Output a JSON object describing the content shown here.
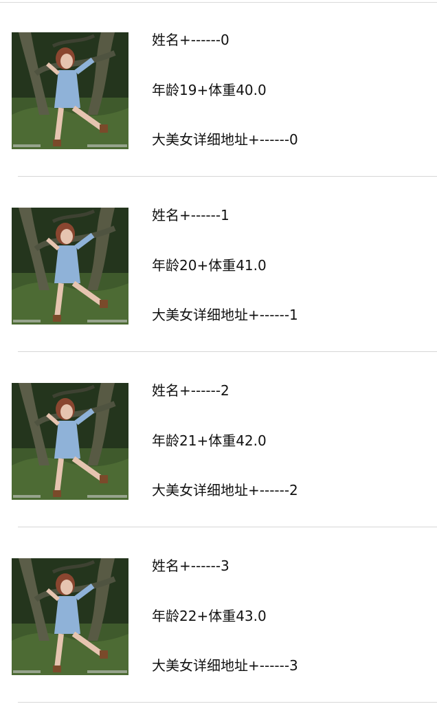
{
  "list": {
    "items": [
      {
        "name_line": "姓名+------0",
        "age_weight_line": "年龄19+体重40.0",
        "address_line": "大美女详细地址+------0"
      },
      {
        "name_line": "姓名+------1",
        "age_weight_line": "年龄20+体重41.0",
        "address_line": "大美女详细地址+------1"
      },
      {
        "name_line": "姓名+------2",
        "age_weight_line": "年龄21+体重42.0",
        "address_line": "大美女详细地址+------2"
      },
      {
        "name_line": "姓名+------3",
        "age_weight_line": "年龄22+体重43.0",
        "address_line": "大美女详细地址+------3"
      }
    ]
  }
}
